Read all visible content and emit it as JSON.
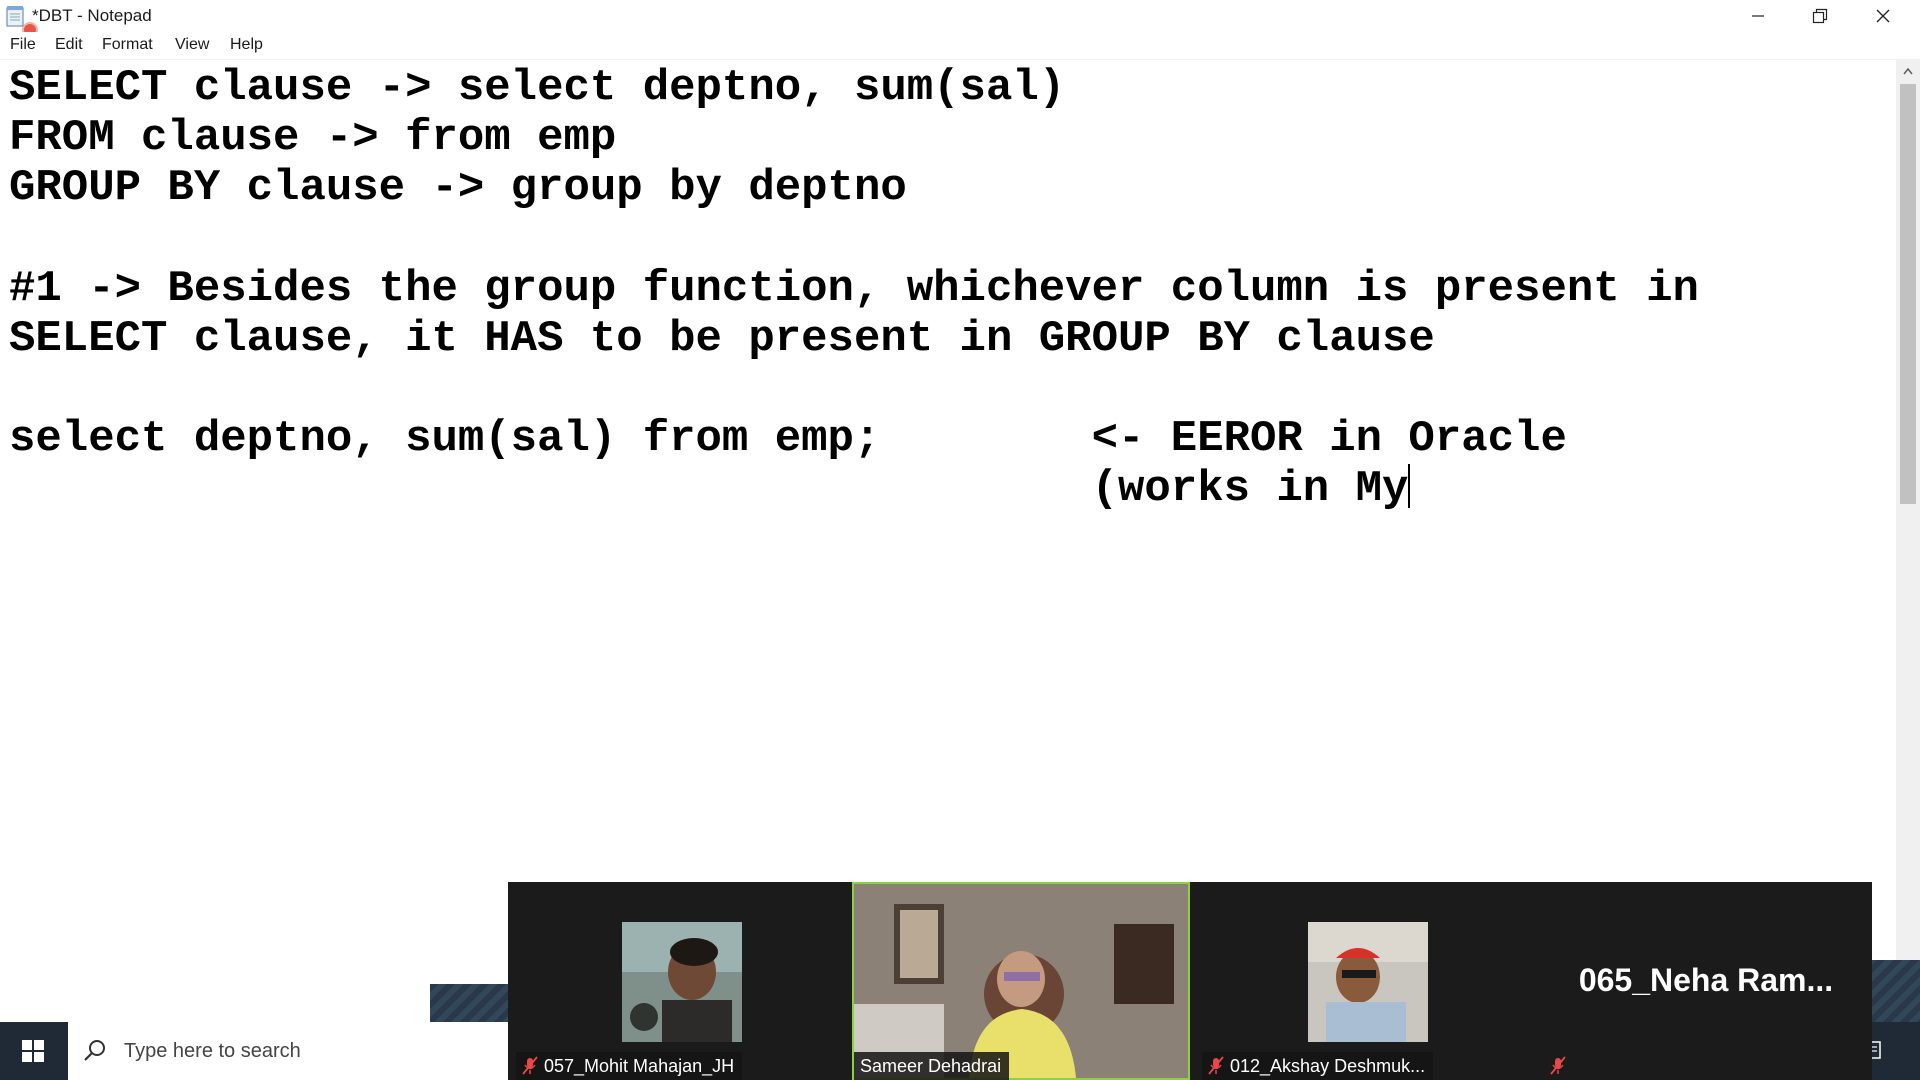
{
  "window": {
    "title": "*DBT - Notepad",
    "controls": {
      "minimize": "minimize",
      "restore": "restore",
      "close": "close"
    }
  },
  "menu": [
    "File",
    "Edit",
    "Format",
    "View",
    "Help"
  ],
  "editor": {
    "lines": [
      "SELECT clause -> select deptno, sum(sal)",
      "FROM clause -> from emp",
      "GROUP BY clause -> group by deptno",
      "",
      "#1 -> Besides the group function, whichever column is present in",
      "SELECT clause, it HAS to be present in GROUP BY clause",
      "",
      "select deptno, sum(sal) from emp;        <- EEROR in Oracle",
      "                                         (works in My"
    ]
  },
  "taskbar": {
    "search_placeholder": "Type here to search"
  },
  "meeting": {
    "participants": [
      {
        "name": "057_Mohit Mahajan_JH",
        "muted": true,
        "active": false
      },
      {
        "name": "Sameer Dehadrai",
        "muted": false,
        "active": true
      },
      {
        "name": "012_Akshay Deshmuk...",
        "muted": true,
        "active": false
      },
      {
        "name": "065_Neha  Ram...",
        "muted": true,
        "active": false,
        "video": false
      }
    ]
  },
  "colors": {
    "taskbar": "#1f2a36",
    "active_speaker_border": "#8bd33c",
    "video_strip": "#1b1b1b"
  }
}
